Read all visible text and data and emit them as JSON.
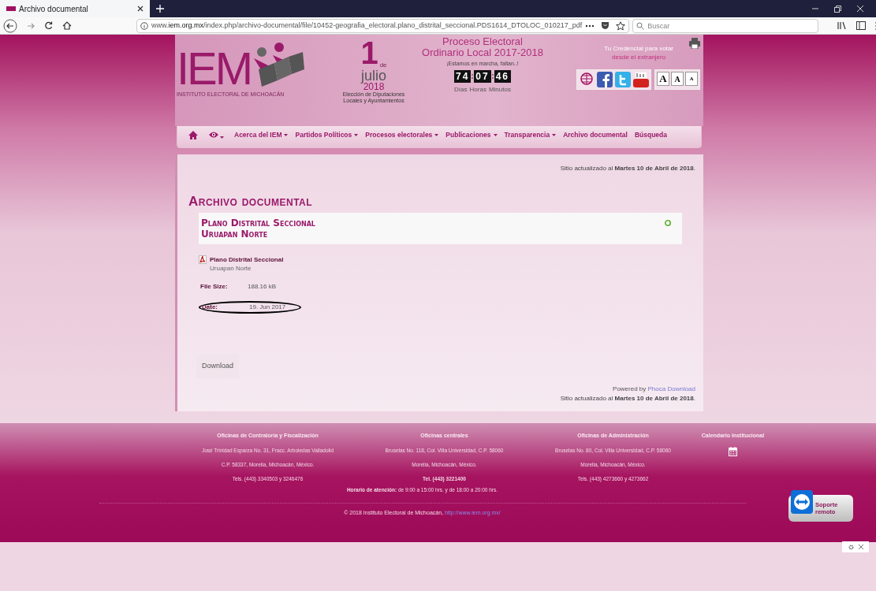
{
  "browser": {
    "tab_title": "Archivo documental",
    "url_prefix": "www.",
    "url_domain": "iem.org.mx",
    "url_path": "/index.php/archivo-documental/file/10452-geografia_electoral.plano_distrital_seccional.PDS1614_DTOLOC_010217_pdf",
    "search_placeholder": "Buscar"
  },
  "header": {
    "logo": "IEM",
    "logo_subtitle": "INSTITUTO ELECTORAL DE MICHOACÁN",
    "day": "1",
    "day_de": "de",
    "month": "julio",
    "year": "2018",
    "election_note": "Elección de Diputaciones Locales y Ayuntamientos",
    "process_lines": [
      "Proceso Electoral",
      "Ordinario Local 2017-2018"
    ],
    "tagline": "¡Estamos en marcha, faltan..!",
    "countdown": [
      "74",
      "07",
      "46"
    ],
    "countdown_units": [
      "Días",
      "Horas",
      "Minutos"
    ],
    "credential_lines": [
      "Tu Credencial para votar",
      "desde el extranjero"
    ],
    "font_buttons": [
      "A",
      "A",
      "A"
    ]
  },
  "nav": [
    {
      "kind": "home"
    },
    {
      "kind": "eye",
      "dropdown": true
    },
    {
      "kind": "text",
      "label": "Acerca del IEM",
      "dropdown": true
    },
    {
      "kind": "text",
      "label": "Partidos Políticos",
      "dropdown": true
    },
    {
      "kind": "text",
      "label": "Procesos electorales",
      "dropdown": true
    },
    {
      "kind": "text",
      "label": "Publicaciones",
      "dropdown": true
    },
    {
      "kind": "text",
      "label": "Transparencia",
      "dropdown": true
    },
    {
      "kind": "text",
      "label": "Archivo documental",
      "dropdown": false
    },
    {
      "kind": "text",
      "label": "Búsqueda",
      "dropdown": false
    }
  ],
  "content": {
    "updated": "Sitio actualizado al **Martes 10 de Abril de 2018**.",
    "heading": "Archivo documental",
    "file_heading_lines": [
      "Plano Distrital Seccional",
      "Uruapan Norte"
    ],
    "file_title": "Plano Distrital Seccional",
    "file_subtitle": "Uruapan Norte",
    "details": [
      {
        "label": "File Size:",
        "value": "188.16 kB",
        "circled": false
      },
      {
        "label": "Date:",
        "value": "19. Jun 2017",
        "circled": true
      }
    ],
    "download": "Download",
    "powered_prefix": "Powered by ",
    "powered_link": "Phoca Download",
    "updated_bottom": "Sitio actualizado al **Martes 10 de Abril de 2018**."
  },
  "footer": {
    "columns": [
      {
        "title": "Oficinas de Contraloría y Fiscalización",
        "lines": [
          "José Trinidad Esparza No. 31, Fracc. Arboledas Valladolid",
          "C.P. 58337, Morelia, Michoacán, México.",
          "Tels. (443) 3340503 y 3246476"
        ]
      },
      {
        "title": "Oficinas centrales",
        "lines": [
          "Bruselas No. 118, Col. Villa Universidad, C.P. 58060",
          "Morelia, Michoacán, México.",
          "**Tel. (443) 3221400**"
        ]
      },
      {
        "title": "Oficinas de Administración",
        "lines": [
          "Bruselas No. 80, Col. Villa Universidad, C.P. 58060",
          "Morelia, Michoacán, México.",
          "Tels. (443) 4273660 y 4273662"
        ]
      },
      {
        "title": "Calendario Institucional"
      }
    ],
    "hours": "**Horario de atención:** de 9:00 a 15:00 hrs. y de 18:00 a 20:00 hrs.",
    "copyright": "© 2018 Instituto Electoral de Michoacán, ",
    "copyright_link": "http://www.iem.org.mx/"
  },
  "support_button": {
    "lines": [
      "Soporte",
      "remoto"
    ]
  }
}
